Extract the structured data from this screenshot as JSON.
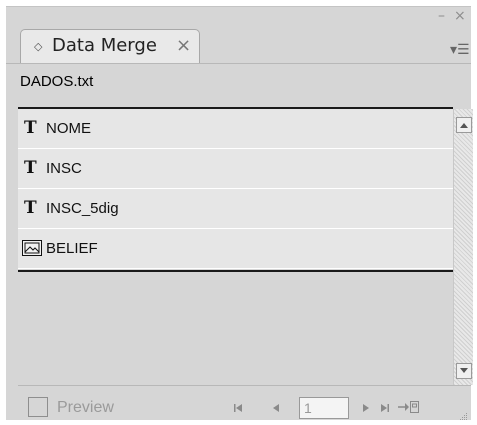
{
  "panel": {
    "tab_title": "Data Merge",
    "tab_close": "×",
    "tab_arrows": "◇",
    "minimize_glyph": "–",
    "close_glyph": "×",
    "menu_glyph": "▾☰"
  },
  "source_file": "DADOS.txt",
  "fields": [
    {
      "label": "NOME",
      "icon": "text-field-icon"
    },
    {
      "label": "INSC",
      "icon": "text-field-icon"
    },
    {
      "label": "INSC_5dig",
      "icon": "text-field-icon"
    },
    {
      "label": "BELIEF",
      "icon": "image-field-icon"
    }
  ],
  "text_icon_glyph": "T",
  "footer": {
    "preview_label": "Preview",
    "record_number": "1"
  },
  "colors": {
    "panel_bg": "#d6d6d6",
    "row_bg": "#e6e6e6",
    "disabled_text": "#9a9a9a"
  }
}
